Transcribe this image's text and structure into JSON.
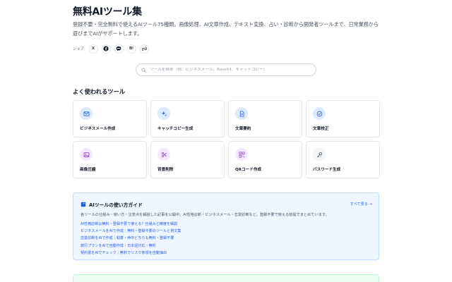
{
  "page": {
    "title": "無料AIツール集",
    "description": "登録不要・完全無料で使えるAIツール75種類。画像処理、AI文章作成、テキスト変換、占い・診断から開発者ツールまで、日常業務から遊びまでAIがサポートします。"
  },
  "share": {
    "label": "シェア",
    "buttons": [
      {
        "icon": "x-icon",
        "text": "X"
      },
      {
        "icon": "facebook-icon",
        "text": ""
      },
      {
        "icon": "line-icon",
        "text": ""
      },
      {
        "icon": "hatena-icon",
        "text": "B!"
      },
      {
        "icon": "link-icon",
        "text": ""
      }
    ]
  },
  "search": {
    "placeholder": "ツールを検索（例：ビジネスメール、Base64、キャッチコピー）"
  },
  "popular": {
    "title": "よく使われるツール",
    "tools": [
      {
        "label": "ビジネスメール作成",
        "icon": "mail-icon",
        "color": "#2563eb",
        "bg": "#dbeafe"
      },
      {
        "label": "キャッチコピー生成",
        "icon": "sparkle-icon",
        "color": "#2563eb",
        "bg": "#dbeafe"
      },
      {
        "label": "文章要約",
        "icon": "document-icon",
        "color": "#2563eb",
        "bg": "#dbeafe"
      },
      {
        "label": "文章校正",
        "icon": "check-circle-icon",
        "color": "#2563eb",
        "bg": "#dbeafe"
      },
      {
        "label": "画像圧縮",
        "icon": "image-icon",
        "color": "#9333ea",
        "bg": "#f3e8ff"
      },
      {
        "label": "背景削除",
        "icon": "scissors-icon",
        "color": "#9333ea",
        "bg": "#f3e8ff"
      },
      {
        "label": "QRコード作成",
        "icon": "qr-icon",
        "color": "#9333ea",
        "bg": "#f3e8ff"
      },
      {
        "label": "パスワード生成",
        "icon": "key-icon",
        "color": "#4b5563",
        "bg": "#f3f4f6"
      }
    ]
  },
  "guide": {
    "icon": "book-icon",
    "title": "AIツールの使い方ガイド",
    "more_label": "すべて見る →",
    "description": "各ツールの仕組み・使い方・注意点を解説した記事を公開中。AI性格診断・ビジネスメール・恋愛診断など、登録不要で使える前提でまとめています。",
    "links": [
      "AI性格診断は無料・登録不要で使える？仕組みと精度を解説",
      "ビジネスメールをAIで作成｜無料・登録不要のツールと例文集",
      "恋愛診断をAIで作成｜粘着・命中どちらも無料・登録不要",
      "旅行プランをAIで自動作成｜日本語対応・無料",
      "契約書をAIでチェック｜無料でリスク条項を自動抽出"
    ]
  }
}
